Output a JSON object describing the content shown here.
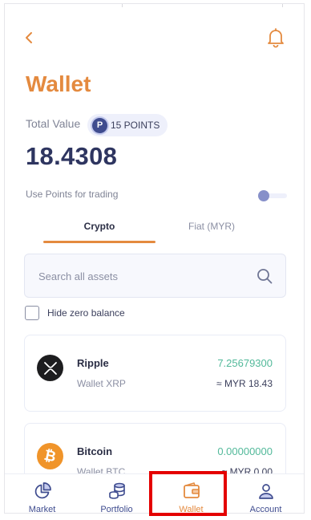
{
  "header": {
    "back_icon": "chevron-left-icon",
    "bell_icon": "bell-icon",
    "title": "Wallet"
  },
  "summary": {
    "total_value_label": "Total Value",
    "points_badge": "P",
    "points_label": "15 POINTS",
    "total_value": "18.4308"
  },
  "use_points": {
    "label": "Use Points for trading",
    "enabled": false
  },
  "tabs": [
    {
      "label": "Crypto",
      "active": true
    },
    {
      "label": "Fiat (MYR)",
      "active": false
    }
  ],
  "search": {
    "placeholder": "Search all assets",
    "value": ""
  },
  "hide_zero": {
    "label": "Hide zero balance",
    "checked": false
  },
  "assets": [
    {
      "name": "Ripple",
      "wallet": "Wallet XRP",
      "amount": "7.25679300",
      "myr": "≈ MYR 18.43",
      "icon": "xrp-icon",
      "color": "#1d1d1f"
    },
    {
      "name": "Bitcoin",
      "wallet": "Wallet BTC",
      "amount": "0.00000000",
      "myr": "≈ MYR 0.00",
      "icon": "bitcoin-icon",
      "color": "#f0942a"
    }
  ],
  "nav": [
    {
      "label": "Market",
      "icon": "pie-chart-icon",
      "active": false
    },
    {
      "label": "Portfolio",
      "icon": "coins-stack-icon",
      "active": false
    },
    {
      "label": "Wallet",
      "icon": "wallet-icon",
      "active": true
    },
    {
      "label": "Account",
      "icon": "user-icon",
      "active": false
    }
  ],
  "colors": {
    "accent": "#e48a3f",
    "primary": "#2e3560",
    "positive": "#52b99a",
    "highlight_box": "#e40000"
  }
}
